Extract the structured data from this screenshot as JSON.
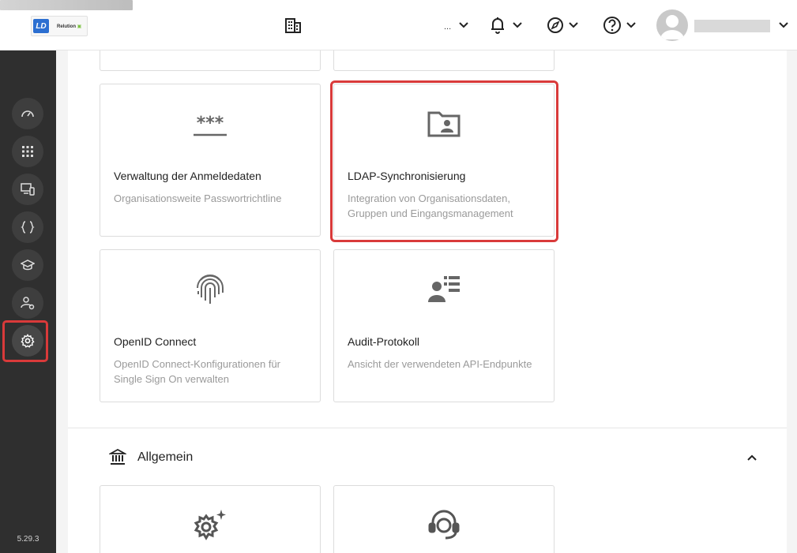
{
  "header": {
    "logo_text": "LD",
    "logo_brand": "Relution",
    "org_suffix": "...",
    "icons": [
      "building-icon",
      "bell-icon",
      "compass-icon",
      "help-icon",
      "user-avatar"
    ]
  },
  "sidebar": {
    "items": [
      {
        "name": "dashboard-icon"
      },
      {
        "name": "apps-grid-icon"
      },
      {
        "name": "devices-icon"
      },
      {
        "name": "code-braces-icon"
      },
      {
        "name": "education-icon"
      },
      {
        "name": "users-settings-icon"
      },
      {
        "name": "settings-gear-icon",
        "active": true
      }
    ],
    "version": "5.29.3"
  },
  "cards": [
    {
      "title": "Verwaltung der Anmeldedaten",
      "description": "Organisationsweite Passwortrichtline",
      "icon": "password-icon"
    },
    {
      "title": "LDAP-Synchronisierung",
      "description": "Integration von Organisationsdaten, Gruppen und Eingangsmanagement",
      "icon": "folder-user-icon",
      "highlighted": true
    },
    {
      "title": "OpenID Connect",
      "description": "OpenID Connect-Konfigurationen für Single Sign On verwalten",
      "icon": "fingerprint-icon"
    },
    {
      "title": "Audit-Protokoll",
      "description": "Ansicht der verwendeten API-Endpunkte",
      "icon": "audit-log-icon"
    }
  ],
  "section": {
    "title": "Allgemein",
    "icon": "bank-icon"
  },
  "colors": {
    "highlight": "#d93a3a",
    "sidebar": "#2f2f2f",
    "accent": "#2c6fd1"
  }
}
